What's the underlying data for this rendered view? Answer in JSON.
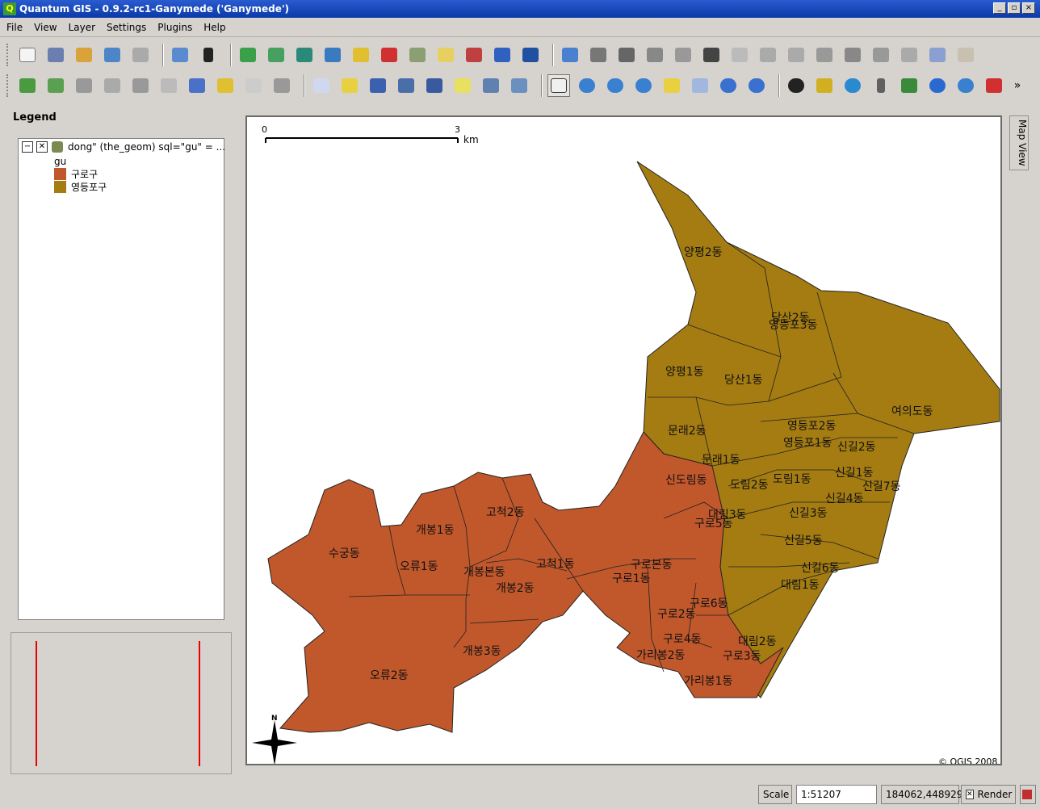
{
  "window": {
    "title": "Quantum GIS - 0.9.2-rc1-Ganymede ('Ganymede')"
  },
  "menu": [
    "File",
    "View",
    "Layer",
    "Settings",
    "Plugins",
    "Help"
  ],
  "legend": {
    "tab_label": "Legend",
    "layer_name": "dong\" (the_geom) sql=\"gu\" = ...",
    "field": "gu",
    "classes": [
      {
        "label": "구로구",
        "color": "#c0582c"
      },
      {
        "label": "영등포구",
        "color": "#a47c12"
      }
    ]
  },
  "map": {
    "scalebar": {
      "start": "0",
      "end": "3",
      "unit": "km"
    },
    "copyright": "© QGIS 2008",
    "north_label": "N",
    "side_tab": "Map View",
    "labels": [
      "양평2동",
      "당산2동",
      "영등포3동",
      "양평1동",
      "당산1동",
      "여의도동",
      "문래2동",
      "영등포2동",
      "영등포1동",
      "신길2동",
      "문래1동",
      "신도림동",
      "도림2동",
      "도림1동",
      "신길1동",
      "신길7동",
      "신길4동",
      "대림3동",
      "고척2동",
      "개봉1동",
      "수궁동",
      "신길3동",
      "구로5동",
      "신길5동",
      "오류1동",
      "고척1동",
      "구로본동",
      "개봉본동",
      "구로1동",
      "신길6동",
      "개봉2동",
      "대림1동",
      "구로6동",
      "구로2동",
      "구로4동",
      "대림2동",
      "가리봉2동",
      "구로3동",
      "개봉3동",
      "오류2동",
      "가리봉1동"
    ]
  },
  "status": {
    "scale_label": "Scale",
    "scale_value": "1:51207",
    "coords": "184062,448929",
    "render_label": "Render"
  }
}
